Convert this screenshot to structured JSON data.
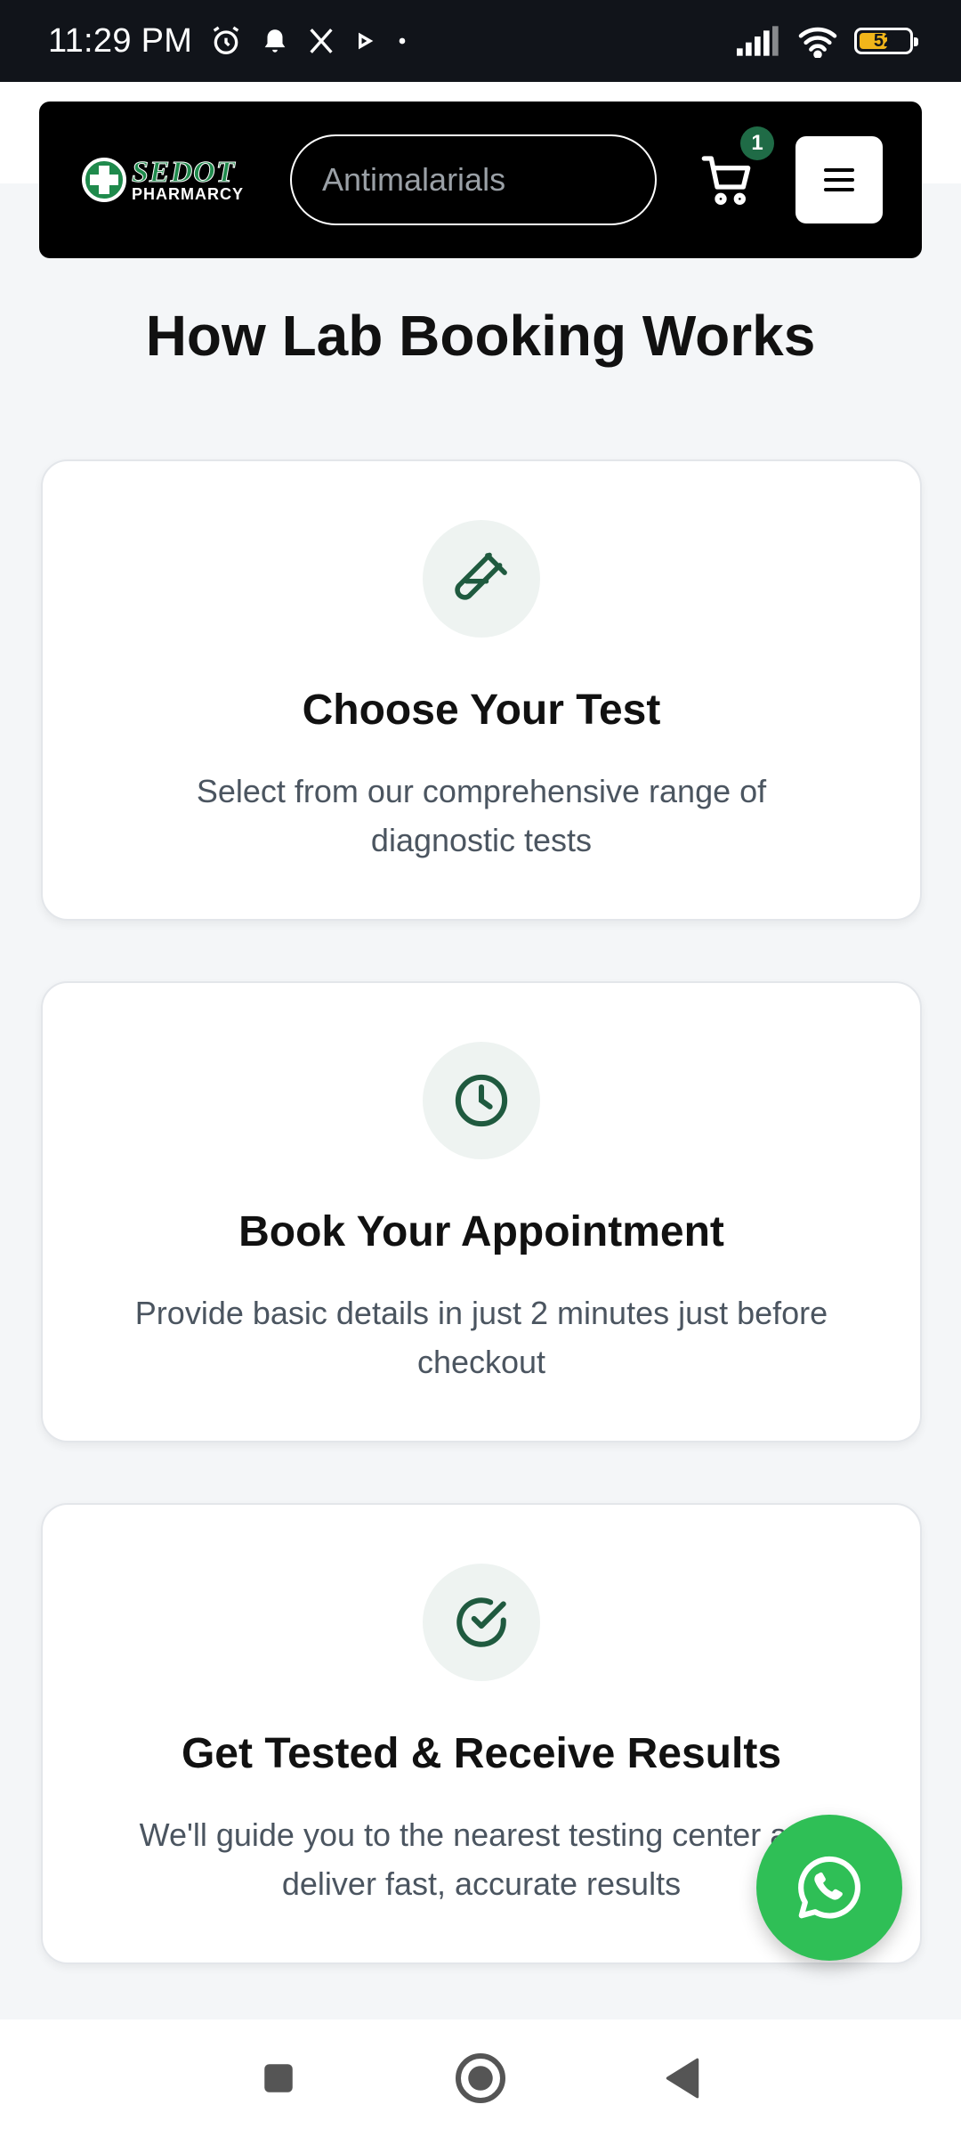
{
  "status_bar": {
    "time": "11:29 PM",
    "battery": "52",
    "battery_level": 0.52,
    "icons": [
      "alarm-icon",
      "bell-icon",
      "x-logo-icon",
      "play-icon",
      "dot-icon",
      "signal-icon",
      "wifi-icon",
      "battery-icon"
    ]
  },
  "header": {
    "logo": {
      "brand": "SEDOT",
      "sub": "PHARMARCY"
    },
    "search": {
      "placeholder": "Antimalarials"
    },
    "cart": {
      "count": "1"
    },
    "menu_icon": "hamburger-icon"
  },
  "section": {
    "title": "How Lab Booking Works"
  },
  "steps": [
    {
      "icon": "test-tube-icon",
      "title": "Choose Your Test",
      "description": "Select from our comprehensive range of diagnostic tests"
    },
    {
      "icon": "clock-icon",
      "title": "Book Your Appointment",
      "description": "Provide basic details in just 2 minutes just before checkout"
    },
    {
      "icon": "check-circle-icon",
      "title": "Get Tested & Receive Results",
      "description": "We'll guide you to the nearest testing center and deliver fast, accurate results"
    }
  ],
  "fab": {
    "icon": "whatsapp-icon"
  },
  "navbar": {
    "icons": [
      "recents-square-icon",
      "home-circle-icon",
      "back-triangle-icon"
    ]
  },
  "colors": {
    "accent": "#1f6b46",
    "icon_bg": "#eef3f1",
    "whatsapp": "#2fbf56",
    "header_bg": "#000000"
  }
}
